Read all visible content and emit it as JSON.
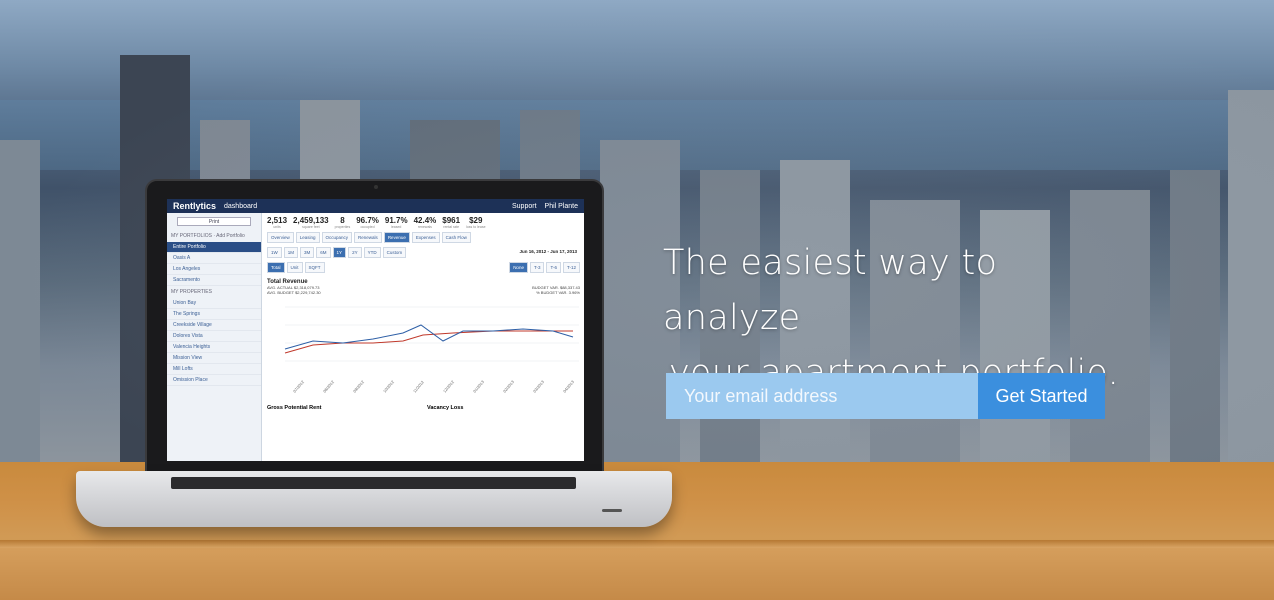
{
  "hero": {
    "headline_line1": "The easiest way to analyze",
    "headline_line2": "your apartment portfolio."
  },
  "signup": {
    "email_placeholder": "Your email address",
    "button_label": "Get Started"
  },
  "app_preview": {
    "logo": "Rentlytics",
    "nav_dashboard": "dashboard",
    "support": "Support",
    "user": "Phil Plante",
    "print_label": "Print",
    "add_portfolio": "Add Portfolio",
    "my_portfolios": "MY PORTFOLIOS",
    "portfolios": [
      "Entire Portfolio",
      "Oasis A",
      "Los Angeles",
      "Sacramento"
    ],
    "my_properties": "MY PROPERTIES",
    "properties": [
      "Union Bay",
      "The Springs",
      "Creekside Village",
      "Dolores Vista",
      "Valencia Heights",
      "Mission View",
      "Mill Lofts",
      "Omission Place"
    ],
    "stats": [
      {
        "value": "2,513",
        "label": "units"
      },
      {
        "value": "2,459,133",
        "label": "square feet"
      },
      {
        "value": "8",
        "label": "properties"
      },
      {
        "value": "96.7%",
        "label": "occupied"
      },
      {
        "value": "91.7%",
        "label": "leased"
      },
      {
        "value": "42.4%",
        "label": "renewals"
      },
      {
        "value": "$961",
        "label": "rental rate"
      },
      {
        "value": "$29",
        "label": "loss to lease"
      }
    ],
    "tabs": [
      "Overview",
      "Leasing",
      "Occupancy",
      "Renewals",
      "Revenue",
      "Expenses",
      "Cash Flow"
    ],
    "active_tab": "Revenue",
    "ranges": [
      "1W",
      "1M",
      "3M",
      "6M",
      "1Y",
      "2Y",
      "YTD",
      "Custom"
    ],
    "date_range": "Jun 16, 2012 - Jun 17, 2013",
    "modes": [
      "Total",
      "Unit",
      "SQFT"
    ],
    "compare": [
      "None",
      "T-3",
      "T-6",
      "T-12"
    ],
    "chart1_title": "Total Revenue",
    "chart1_actual": "AVG. ACTUAL  $2,318,079.73",
    "chart1_budget": "AVG. BUDGET  $2,229,742.30",
    "chart1_budget_var": "BUDGET VAR.  $88,337.43",
    "chart1_budget_var_pct": "% BUDGET VAR.  3.96%",
    "chart2_title": "Gross Potential Rent",
    "chart3_title": "Vacancy Loss"
  }
}
